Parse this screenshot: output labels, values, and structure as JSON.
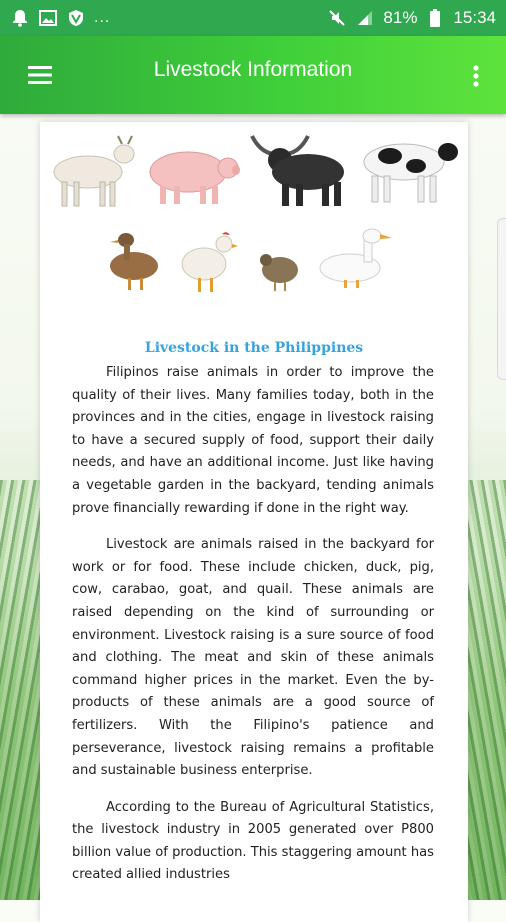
{
  "status_bar": {
    "overflow_indicator": "...",
    "battery": "81%",
    "time": "15:34",
    "icons": [
      "bell-icon",
      "image-icon",
      "shield-icon",
      "mute-icon",
      "signal-icon",
      "battery-icon"
    ]
  },
  "app_bar": {
    "title": "Livestock Information",
    "color": "#3fcf3a"
  },
  "article": {
    "title": "Livestock in the Philippines",
    "title_color": "#36a3de",
    "images": [
      "goat",
      "pig",
      "carabao",
      "cow",
      "duck",
      "chicken",
      "quail",
      "white-duck"
    ],
    "paragraphs": [
      "Filipinos raise animals in order to improve the quality of their lives. Many families today, both in the provinces and in the cities, engage in livestock raising to have a secured supply of food, support their daily needs, and have an additional income. Just like having a vegetable garden in the backyard, tending animals prove financially rewarding if done in the right way.",
      "Livestock are animals raised in the backyard for work or for food. These include chicken, duck, pig, cow, carabao, goat, and quail. These animals are raised depending on the kind of surrounding or environment. Livestock raising is a sure source of food and clothing. The meat and skin of these animals command higher prices in the market. Even the by-products of these animals are a good source of fertilizers. With the Filipino's patience and perseverance, livestock raising remains a profitable and sustainable business enterprise.",
      "According to the Bureau of Agricultural Statistics, the livestock industry in 2005 generated over P800 billion value of production. This staggering amount has created allied industries"
    ]
  }
}
